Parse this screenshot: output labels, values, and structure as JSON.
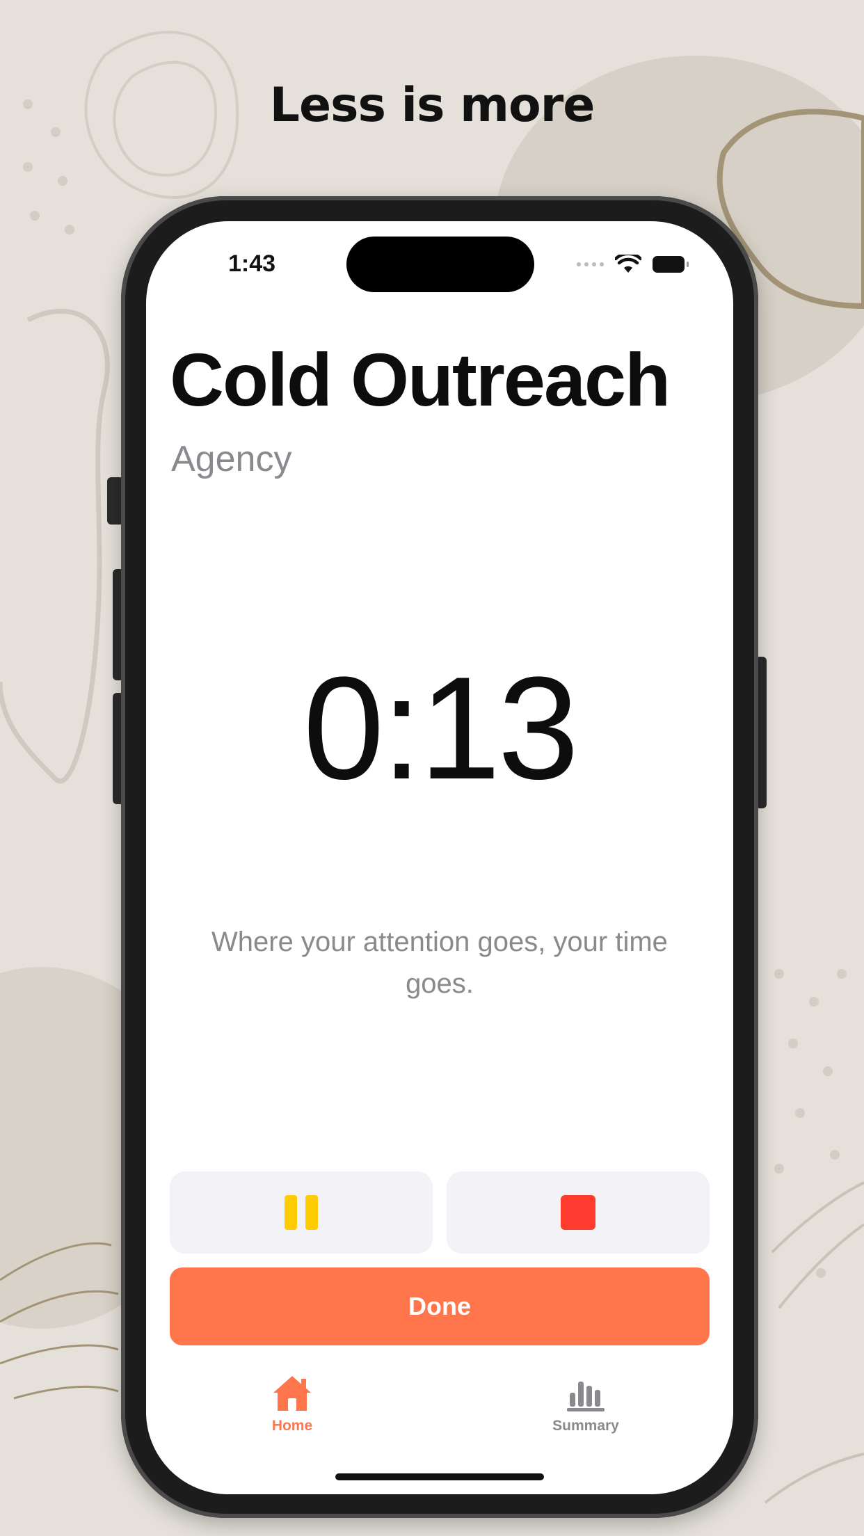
{
  "headline": "Less is more",
  "status_bar": {
    "time": "1:43"
  },
  "task": {
    "title": "Cold Outreach",
    "category": "Agency"
  },
  "timer": {
    "value": "0:13"
  },
  "quote": "Where your attention goes, your time goes.",
  "controls": {
    "pause_icon": "pause-icon",
    "stop_icon": "stop-icon",
    "done_label": "Done"
  },
  "tab_bar": {
    "items": [
      {
        "label": "Home",
        "icon": "home-icon",
        "active": true
      },
      {
        "label": "Summary",
        "icon": "bar-chart-icon",
        "active": false
      }
    ]
  },
  "colors": {
    "accent": "#ff764d",
    "pause": "#ffcc00",
    "stop": "#ff3b30",
    "inactive": "#8a8a8e",
    "background": "#e5e1da"
  }
}
